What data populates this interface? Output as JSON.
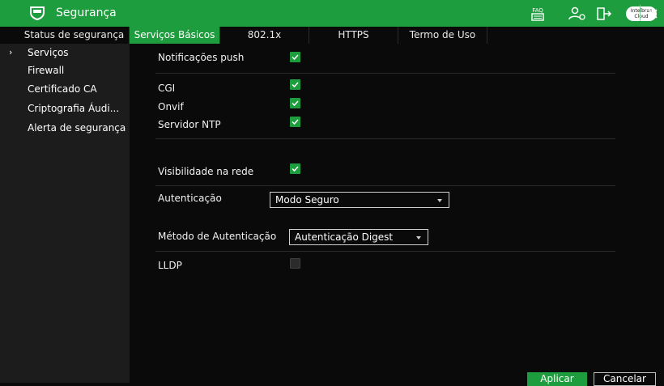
{
  "window": {
    "title": "Segurança",
    "toolbar": {
      "faq_label": "FAQ",
      "cloud_line1": "Intelbras",
      "cloud_line2": "Cloud"
    }
  },
  "tabs": [
    {
      "label": "Status de segurança",
      "active": false
    },
    {
      "label": "Serviços Básicos",
      "active": true
    },
    {
      "label": "802.1x",
      "active": false
    },
    {
      "label": "HTTPS",
      "active": false
    },
    {
      "label": "Termo de Uso",
      "active": false
    }
  ],
  "sidebar": {
    "items": [
      {
        "label": "Serviços",
        "selected": true
      },
      {
        "label": "Firewall",
        "selected": false
      },
      {
        "label": "Certificado CA",
        "selected": false
      },
      {
        "label": "Criptografia Áudi...",
        "selected": false
      },
      {
        "label": "Alerta de segurança",
        "selected": false
      }
    ]
  },
  "settings": {
    "push_notifications": {
      "label": "Notificações push",
      "checked": true
    },
    "cgi": {
      "label": "CGI",
      "checked": true
    },
    "onvif": {
      "label": "Onvif",
      "checked": true
    },
    "ntp_server": {
      "label": "Servidor NTP",
      "checked": true
    },
    "network_visibility": {
      "label": "Visibilidade na rede",
      "checked": true
    },
    "authentication": {
      "label": "Autenticação",
      "value": "Modo Seguro"
    },
    "auth_method": {
      "label": "Método de Autenticação",
      "value": "Autenticação Digest"
    },
    "lldp": {
      "label": "LLDP",
      "checked": false
    }
  },
  "buttons": {
    "apply": "Aplicar",
    "cancel": "Cancelar"
  },
  "colors": {
    "accent": "#1e9d3e",
    "background": "#0a0a0a",
    "sidebar": "#1c1c1c"
  }
}
